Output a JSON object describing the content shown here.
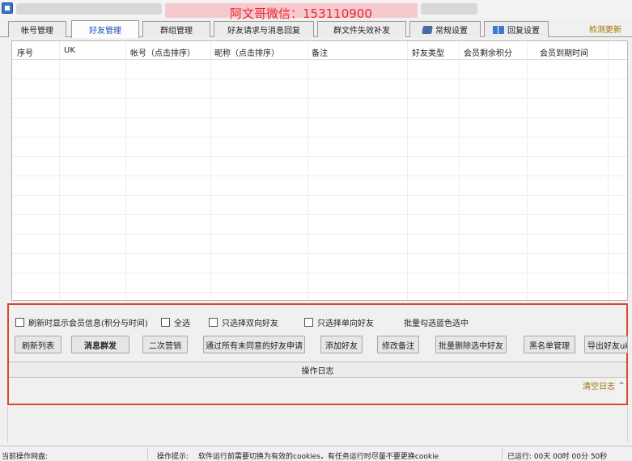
{
  "window": {
    "watermark_text": "阿文哥微信：153110900"
  },
  "tabs": [
    {
      "label": "帐号管理",
      "active": false
    },
    {
      "label": "好友管理",
      "active": true
    },
    {
      "label": "群组管理",
      "active": false
    },
    {
      "label": "好友请求与消息回复",
      "active": false
    },
    {
      "label": "群文件失效补发",
      "active": false
    },
    {
      "label": "常规设置",
      "active": false,
      "icon": "gear-icon"
    },
    {
      "label": "回复设置",
      "active": false,
      "icon": "book-icon"
    }
  ],
  "check_update_label": "检测更新",
  "table": {
    "columns": [
      "序号",
      "UK",
      "帐号（点击排序）",
      "昵称（点击排序）",
      "备注",
      "好友类型",
      "会员剩余积分",
      "会员到期时间"
    ],
    "rows": []
  },
  "options": {
    "refresh_show_member_info": "刷新时显示会员信息(积分与时间)",
    "select_all": "全选",
    "only_bidirectional": "只选择双向好友",
    "only_unidirectional": "只选择单向好友",
    "batch_check_hint": "批量勾选蓝色选中"
  },
  "buttons": {
    "refresh_list": "刷新列表",
    "message_broadcast": "消息群发",
    "second_marketing": "二次营销",
    "accept_all_requests": "通过所有未同意的好友申请",
    "add_friend": "添加好友",
    "edit_note": "修改备注",
    "batch_delete": "批量删除选中好友",
    "blacklist": "黑名单管理",
    "export_friends": "导出好友uk"
  },
  "log": {
    "header": "操作日志",
    "clear_label": "清空日志"
  },
  "statusbar": {
    "current_disk_label": "当前操作网盘:",
    "current_disk_value": "",
    "tip_label": "操作提示:",
    "tip_text": "软件运行前需要切换为有效的cookies，有任务运行时尽量不要更换cookie",
    "runtime_text": "已运行: 00天 00时 00分 50秒"
  },
  "colors": {
    "highlight_border": "#d9482b",
    "active_tab_text": "#1a4fc0",
    "watermark_red": "#e8283a",
    "link_gold": "#a07000"
  }
}
